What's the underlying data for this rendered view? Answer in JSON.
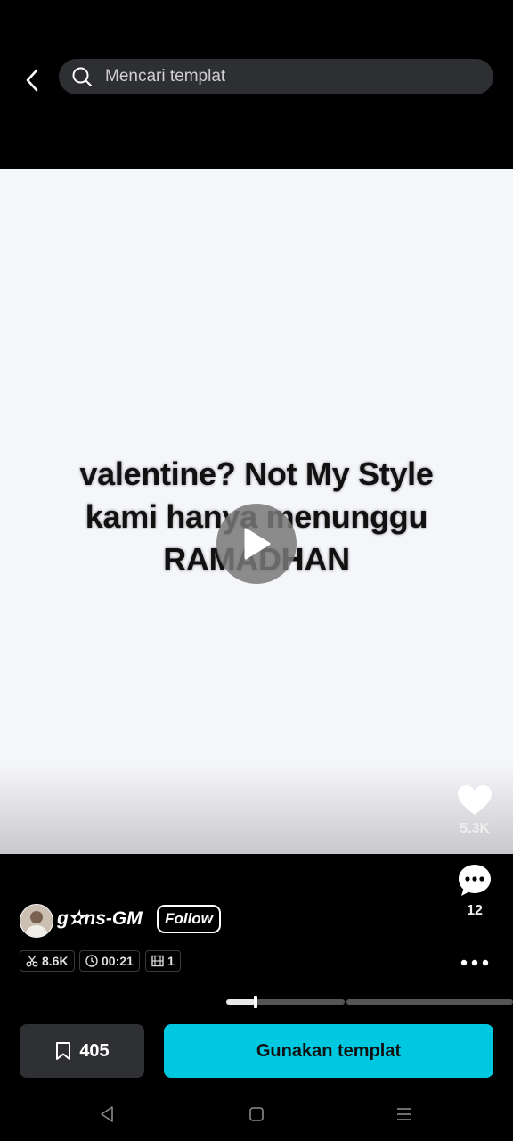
{
  "search": {
    "placeholder": "Mencari templat"
  },
  "video": {
    "caption_lines": [
      "valentine? Not My Style",
      "kami hanya menunggu",
      "RAMADHAN"
    ]
  },
  "actions": {
    "likes": "5.3K",
    "comments": "12"
  },
  "author": {
    "name": "g✫ns-GM",
    "follow_label": "Follow"
  },
  "stats": {
    "uses": "8.6K",
    "duration": "00:21",
    "clips": "1"
  },
  "progress": {
    "segments": 2,
    "active_segment_fraction": 0.25
  },
  "bottom": {
    "save_count": "405",
    "use_label": "Gunakan templat",
    "accent_color": "#00c8e0"
  },
  "icons": [
    "back-icon",
    "search-icon",
    "play-icon",
    "heart-icon",
    "comment-icon",
    "more-icon",
    "scissors-icon",
    "clock-icon",
    "film-icon",
    "bookmark-icon",
    "nav-back-icon",
    "nav-home-icon",
    "nav-menu-icon"
  ]
}
